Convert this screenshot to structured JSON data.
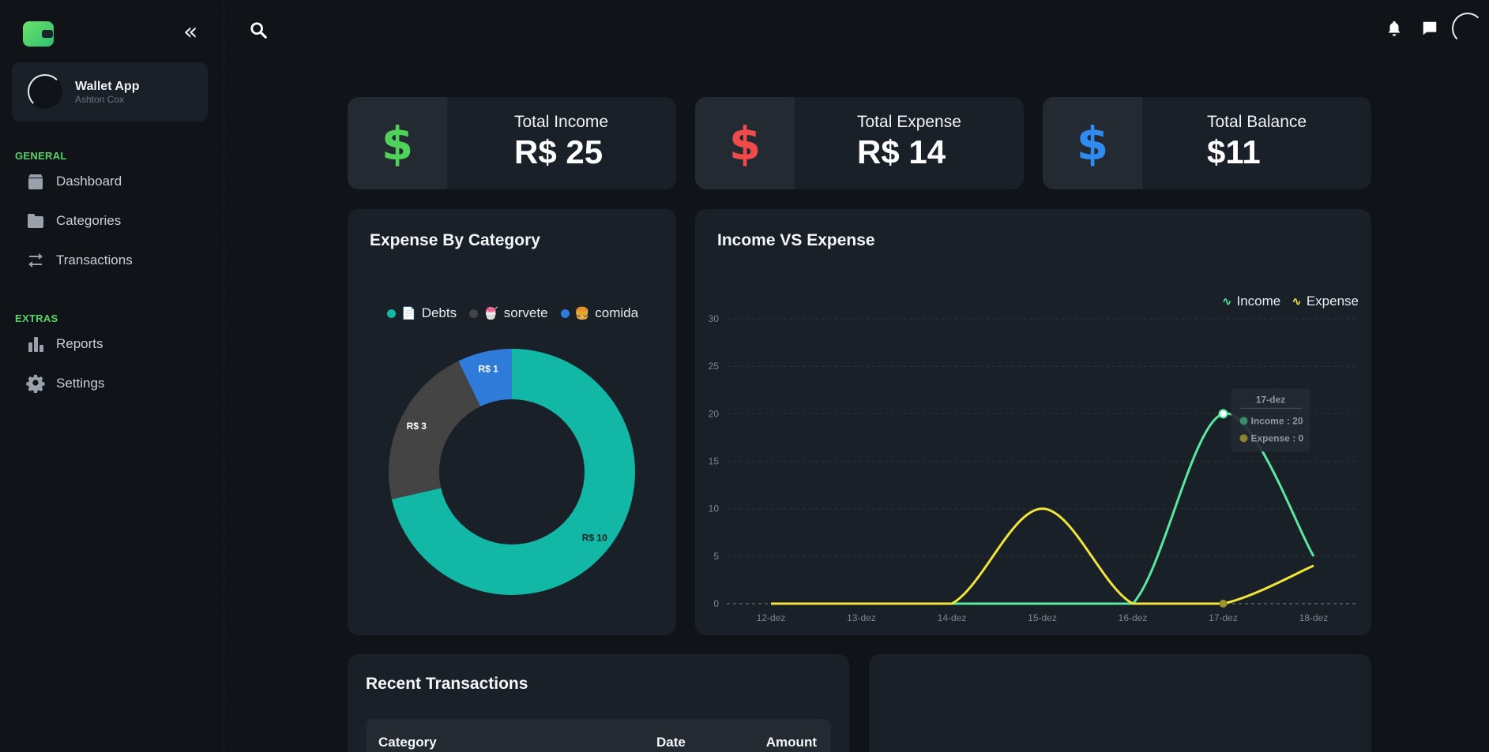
{
  "app": {
    "name": "Wallet App",
    "username": "Ashton Cox"
  },
  "nav": {
    "groups": [
      {
        "label": "GENERAL"
      },
      {
        "label": "EXTRAS"
      }
    ],
    "items": [
      {
        "label": "Dashboard",
        "icon": "dashboard-icon"
      },
      {
        "label": "Categories",
        "icon": "folder-icon"
      },
      {
        "label": "Transactions",
        "icon": "transfer-icon"
      },
      {
        "label": "Reports",
        "icon": "bar-chart-icon"
      },
      {
        "label": "Settings",
        "icon": "gear-icon"
      }
    ]
  },
  "stats": [
    {
      "label": "Total Income",
      "value": "R$ 25",
      "icon": "$",
      "color": "#4fd15a"
    },
    {
      "label": "Total Expense",
      "value": "R$ 14",
      "icon": "$",
      "color": "#f04a4a"
    },
    {
      "label": "Total Balance",
      "value": "$11",
      "icon": "$",
      "color": "#2f8bf0"
    }
  ],
  "donut": {
    "title": "Expense By Category",
    "legend": [
      {
        "label": "Debts",
        "emoji": "📄",
        "color": "#12b8a5"
      },
      {
        "label": "sorvete",
        "emoji": "🍧",
        "color": "#444444"
      },
      {
        "label": "comida",
        "emoji": "🍔",
        "color": "#2f7bd9"
      }
    ]
  },
  "line_chart": {
    "title": "Income VS Expense",
    "tooltip": {
      "title": "17-dez",
      "income": "Income : 20",
      "expense": "Expense : 0"
    }
  },
  "recent": {
    "title": "Recent Transactions",
    "columns": [
      "Category",
      "Date",
      "Amount"
    ]
  },
  "chart_data": [
    {
      "type": "pie",
      "title": "Expense By Category",
      "labels": [
        "Debts",
        "sorvete",
        "comida"
      ],
      "values": [
        10,
        3,
        1
      ],
      "value_labels": [
        "R$ 10",
        "R$ 3",
        "R$ 1"
      ],
      "colors": [
        "#12b8a5",
        "#444444",
        "#2f7bd9"
      ],
      "donut": true
    },
    {
      "type": "line",
      "title": "Income VS Expense",
      "categories": [
        "12-dez",
        "13-dez",
        "14-dez",
        "15-dez",
        "16-dez",
        "17-dez",
        "18-dez"
      ],
      "series": [
        {
          "name": "Income",
          "color": "#5ae8a0",
          "values": [
            0,
            0,
            0,
            0,
            0,
            20,
            5
          ]
        },
        {
          "name": "Expense",
          "color": "#f2e53a",
          "values": [
            0,
            0,
            0,
            10,
            0,
            0,
            4
          ]
        }
      ],
      "ylim": [
        0,
        30
      ],
      "yticks": [
        0,
        5,
        10,
        15,
        20,
        25,
        30
      ],
      "grid": true,
      "legend": "top-right"
    }
  ]
}
